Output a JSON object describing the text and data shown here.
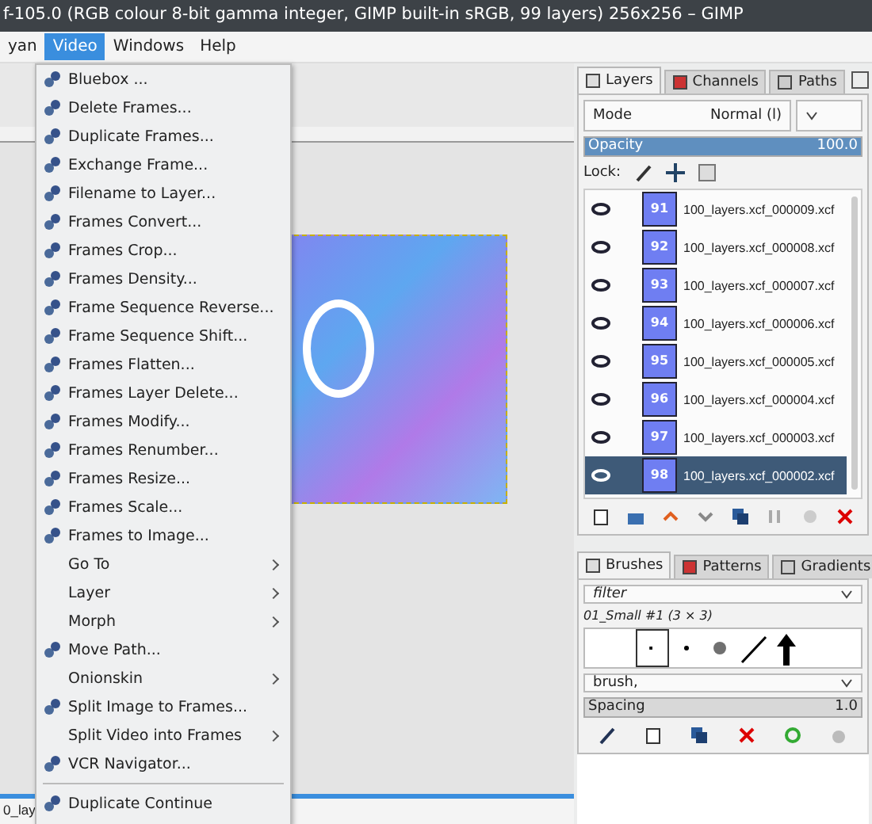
{
  "window": {
    "title": "f-105.0 (RGB colour 8-bit gamma integer, GIMP built-in sRGB, 99 layers) 256x256 – GIMP"
  },
  "menubar": [
    {
      "label": "yan",
      "selected": false
    },
    {
      "label": "Video",
      "selected": true
    },
    {
      "label": "Windows",
      "selected": false
    },
    {
      "label": "Help",
      "selected": false
    }
  ],
  "canvas": {
    "status_text": "0_lay"
  },
  "video_menu": {
    "items": [
      {
        "kind": "plugin",
        "label": "Bluebox ..."
      },
      {
        "kind": "plugin",
        "label": "Delete Frames..."
      },
      {
        "kind": "plugin",
        "label": "Duplicate Frames..."
      },
      {
        "kind": "plugin",
        "label": "Exchange Frame..."
      },
      {
        "kind": "plugin",
        "label": "Filename to Layer..."
      },
      {
        "kind": "plugin",
        "label": "Frames Convert..."
      },
      {
        "kind": "plugin",
        "label": "Frames Crop..."
      },
      {
        "kind": "plugin",
        "label": "Frames Density..."
      },
      {
        "kind": "plugin",
        "label": "Frame Sequence Reverse..."
      },
      {
        "kind": "plugin",
        "label": "Frame Sequence Shift..."
      },
      {
        "kind": "plugin",
        "label": "Frames Flatten..."
      },
      {
        "kind": "plugin",
        "label": "Frames Layer Delete..."
      },
      {
        "kind": "plugin",
        "label": "Frames Modify..."
      },
      {
        "kind": "plugin",
        "label": "Frames Renumber..."
      },
      {
        "kind": "plugin",
        "label": "Frames Resize..."
      },
      {
        "kind": "plugin",
        "label": "Frames Scale..."
      },
      {
        "kind": "plugin",
        "label": "Frames to Image..."
      },
      {
        "kind": "submenu",
        "label": "Go To"
      },
      {
        "kind": "submenu",
        "label": "Layer"
      },
      {
        "kind": "submenu",
        "label": "Morph"
      },
      {
        "kind": "plugin",
        "label": "Move Path..."
      },
      {
        "kind": "submenu",
        "label": "Onionskin"
      },
      {
        "kind": "plugin",
        "label": "Split Image to Frames..."
      },
      {
        "kind": "submenu",
        "label": "Split Video into Frames"
      },
      {
        "kind": "plugin",
        "label": "VCR Navigator..."
      },
      {
        "kind": "separator"
      },
      {
        "kind": "plugin",
        "label": "Duplicate Continue"
      }
    ]
  },
  "layers_dock": {
    "tabs": [
      {
        "label": "Layers",
        "selected": true
      },
      {
        "label": "Channels",
        "selected": false
      },
      {
        "label": "Paths",
        "selected": false
      }
    ],
    "mode_label": "Mode",
    "mode_value": "Normal (l)",
    "opacity": {
      "label": "Opacity",
      "reading": "100.0",
      "level": 1.0
    },
    "lock_label": "Lock:",
    "layers": [
      {
        "thumb": "91",
        "name": "100_layers.xcf_000009.xcf",
        "visible": true,
        "selected": false
      },
      {
        "thumb": "92",
        "name": "100_layers.xcf_000008.xcf",
        "visible": true,
        "selected": false
      },
      {
        "thumb": "93",
        "name": "100_layers.xcf_000007.xcf",
        "visible": true,
        "selected": false
      },
      {
        "thumb": "94",
        "name": "100_layers.xcf_000006.xcf",
        "visible": true,
        "selected": false
      },
      {
        "thumb": "95",
        "name": "100_layers.xcf_000005.xcf",
        "visible": true,
        "selected": false
      },
      {
        "thumb": "96",
        "name": "100_layers.xcf_000004.xcf",
        "visible": true,
        "selected": false
      },
      {
        "thumb": "97",
        "name": "100_layers.xcf_000003.xcf",
        "visible": true,
        "selected": false
      },
      {
        "thumb": "98",
        "name": "100_layers.xcf_000002.xcf",
        "visible": true,
        "selected": true
      }
    ]
  },
  "brushes_dock": {
    "tabs": [
      {
        "label": "Brushes",
        "selected": true
      },
      {
        "label": "Patterns",
        "selected": false
      },
      {
        "label": "Gradients",
        "selected": false
      }
    ],
    "filter_placeholder": "filter",
    "brush_name": "01_Small #1 (3 × 3)",
    "tag_value": "brush,",
    "spacing": {
      "label": "Spacing",
      "reading": "1.0",
      "level": 1.0
    }
  }
}
